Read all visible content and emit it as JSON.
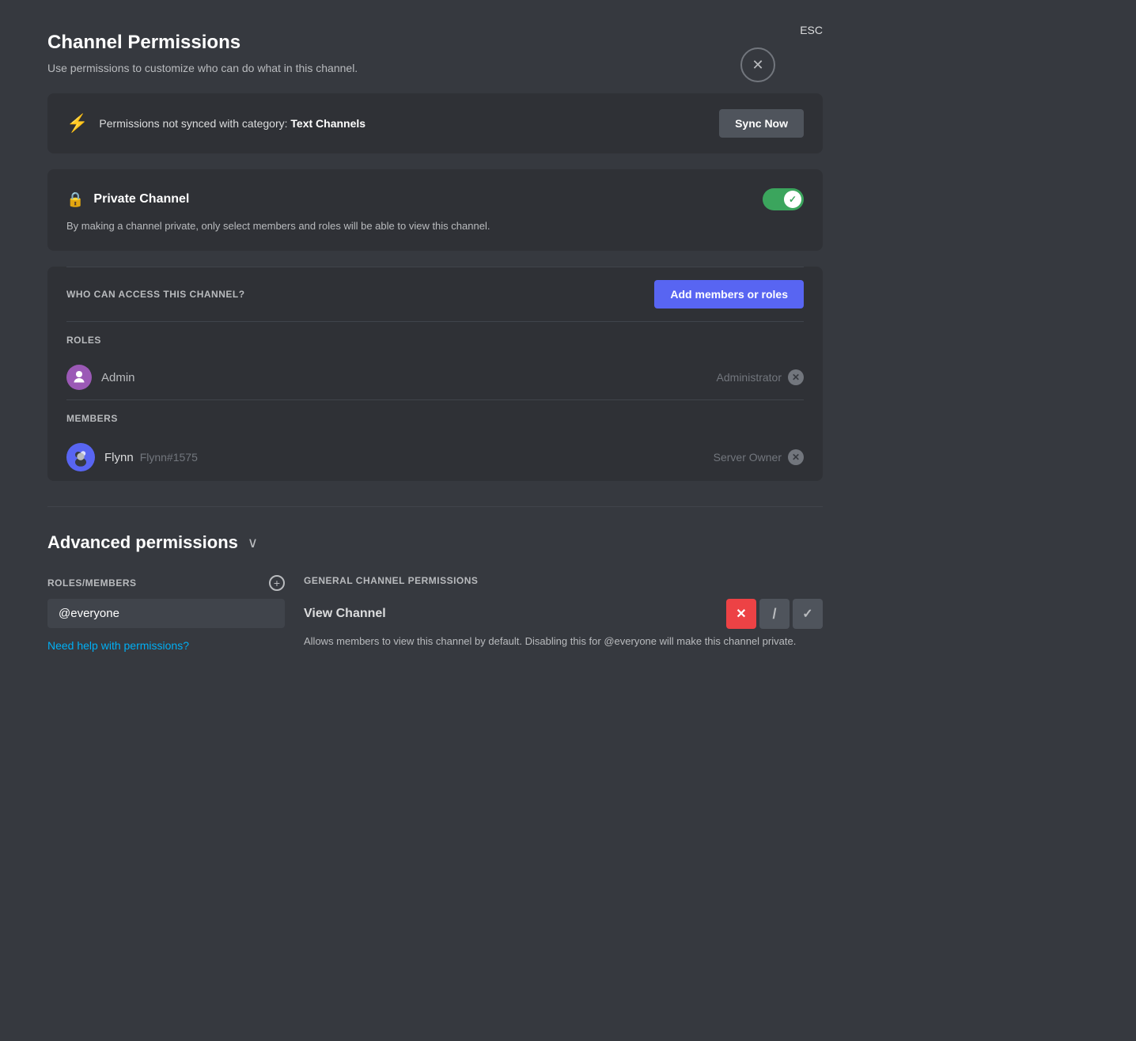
{
  "page": {
    "title": "Channel Permissions",
    "subtitle": "Use permissions to customize who can do what in this channel."
  },
  "close": {
    "icon": "✕",
    "esc_label": "ESC"
  },
  "sync_banner": {
    "icon": "⚡",
    "text_prefix": "Permissions not synced with category: ",
    "category_name": "Text Channels",
    "button_label": "Sync Now"
  },
  "private_channel": {
    "title": "Private Channel",
    "description": "By making a channel private, only select members and roles will be able to view this channel.",
    "toggle_on": true
  },
  "access_section": {
    "label": "WHO CAN ACCESS THIS CHANNEL?",
    "add_button_label": "Add members or roles"
  },
  "roles_section": {
    "label": "ROLES",
    "items": [
      {
        "name": "Admin",
        "badge": "Administrator",
        "icon_color": "#9b59b6"
      }
    ]
  },
  "members_section": {
    "label": "MEMBERS",
    "items": [
      {
        "display_name": "Flynn",
        "username": "Flynn#1575",
        "badge": "Server Owner"
      }
    ]
  },
  "advanced_permissions": {
    "title": "Advanced permissions",
    "chevron": "∨",
    "roles_members": {
      "label": "ROLES/MEMBERS",
      "add_icon": "+",
      "selected": "@everyone"
    },
    "general_channel_permissions": {
      "label": "GENERAL CHANNEL PERMISSIONS",
      "permissions": [
        {
          "name": "View Channel",
          "description": "Allows members to view this channel by default. Disabling this for @everyone will make this channel private.",
          "state": "deny"
        }
      ]
    }
  },
  "help_link": "Need help with permissions?"
}
